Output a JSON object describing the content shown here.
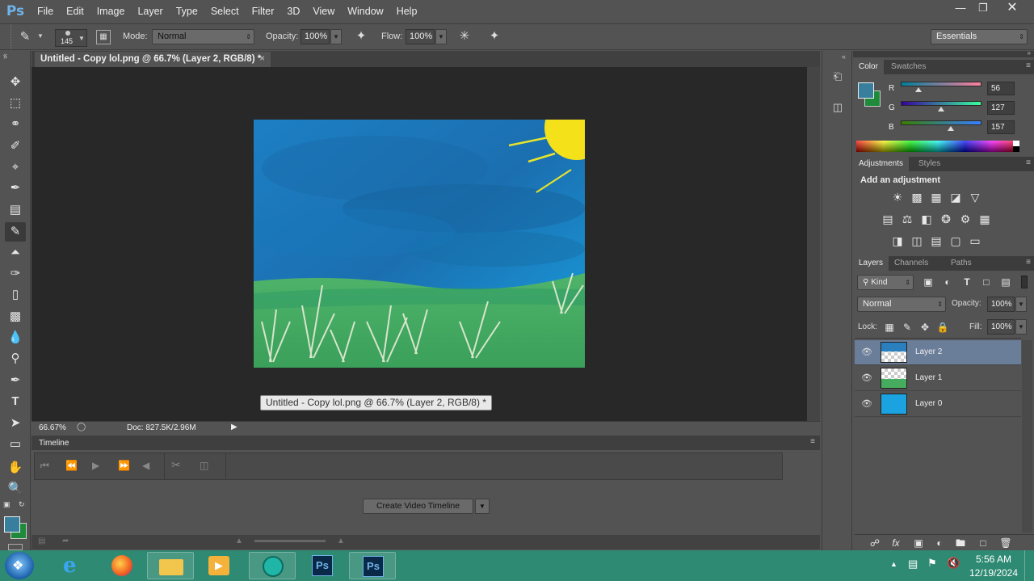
{
  "app": {
    "logo": "Ps",
    "menus": [
      "File",
      "Edit",
      "Image",
      "Layer",
      "Type",
      "Select",
      "Filter",
      "3D",
      "View",
      "Window",
      "Help"
    ]
  },
  "options_bar": {
    "brush_size": "145",
    "mode_label": "Mode:",
    "mode_value": "Normal",
    "opacity_label": "Opacity:",
    "opacity_value": "100%",
    "flow_label": "Flow:",
    "flow_value": "100%",
    "workspace": "Essentials"
  },
  "document": {
    "tab_title": "Untitled - Copy lol.png @ 66.7% (Layer 2, RGB/8) *",
    "tooltip": "Untitled - Copy lol.png @ 66.7% (Layer 2, RGB/8) *",
    "zoom": "66.67%",
    "doc_size": "Doc: 827.5K/2.96M"
  },
  "timeline": {
    "title": "Timeline",
    "create_button": "Create Video Timeline"
  },
  "color_panel": {
    "tabs": [
      "Color",
      "Swatches"
    ],
    "r_label": "R",
    "g_label": "G",
    "b_label": "B",
    "r": 56,
    "g": 127,
    "b": 157,
    "r_str": "56",
    "g_str": "127",
    "b_str": "157",
    "foreground": "#387f9d",
    "background": "#1f8a3a"
  },
  "adjustments_panel": {
    "tabs": [
      "Adjustments",
      "Styles"
    ],
    "heading": "Add an adjustment"
  },
  "layers_panel": {
    "tabs": [
      "Layers",
      "Channels",
      "Paths"
    ],
    "kind_filter": "Kind",
    "blend_mode": "Normal",
    "opacity_label": "Opacity:",
    "opacity_value": "100%",
    "lock_label": "Lock:",
    "fill_label": "Fill:",
    "fill_value": "100%",
    "layers": [
      {
        "name": "Layer 2",
        "selected": true
      },
      {
        "name": "Layer 1",
        "selected": false
      },
      {
        "name": "Layer 0",
        "selected": false
      }
    ]
  },
  "taskbar": {
    "time": "5:56 AM",
    "date": "12/19/2024",
    "apps": [
      "start-button",
      "internet-explorer",
      "firefox",
      "file-explorer",
      "media-player",
      "app-browser",
      "photoshop-installer",
      "photoshop"
    ]
  }
}
